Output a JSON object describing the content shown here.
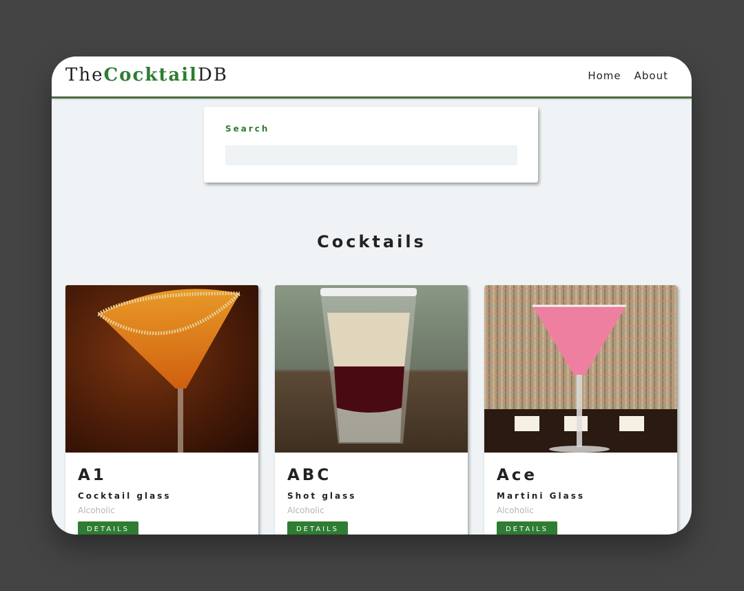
{
  "navbar": {
    "logo_prefix": "The",
    "logo_accent": "Cocktail",
    "logo_suffix": "DB",
    "links": [
      {
        "label": "Home"
      },
      {
        "label": "About"
      }
    ]
  },
  "search": {
    "label": "Search",
    "value": ""
  },
  "section_title": "Cocktails",
  "cocktails": [
    {
      "name": "A1",
      "glass": "Cocktail glass",
      "info": "Alcoholic",
      "button": "DETAILS"
    },
    {
      "name": "ABC",
      "glass": "Shot glass",
      "info": "Alcoholic",
      "button": "DETAILS"
    },
    {
      "name": "Ace",
      "glass": "Martini Glass",
      "info": "Alcoholic",
      "button": "DETAILS"
    }
  ],
  "colors": {
    "accent": "#2f7d32",
    "page_bg": "#eff3f5",
    "outer_bg": "#444444"
  }
}
